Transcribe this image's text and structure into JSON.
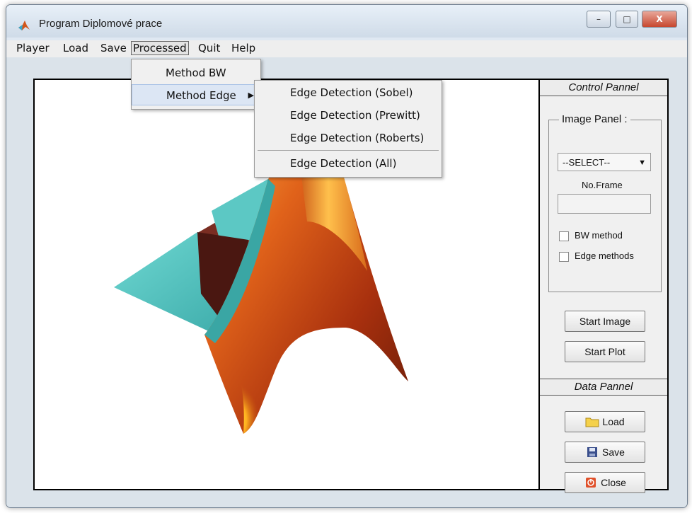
{
  "window": {
    "title": "Program Diplomové prace",
    "controls": [
      "–",
      "□",
      "X"
    ]
  },
  "menubar": [
    "Player",
    "Load",
    "Save",
    "Processed",
    "Quit",
    "Help"
  ],
  "processed_menu": {
    "items": [
      "Method BW",
      "Method Edge"
    ]
  },
  "edge_submenu": {
    "items": [
      "Edge Detection (Sobel)",
      "Edge Detection (Prewitt)",
      "Edge Detection (Roberts)",
      "Edge Detection (All)"
    ]
  },
  "control_panel": {
    "title": "Control Pannel",
    "image_panel_label": "Image Panel :",
    "select_value": "--SELECT--",
    "frame_label": "No.Frame",
    "checkbox_bw": "BW method",
    "checkbox_edge": "Edge methods",
    "start_image": "Start Image",
    "start_plot": "Start Plot"
  },
  "data_panel": {
    "title": "Data Pannel",
    "load": "Load",
    "save": "Save",
    "close": "Close"
  },
  "icons": {
    "app": "matlab-logo-icon",
    "load": "folder-icon",
    "save": "floppy-disk-icon",
    "close": "power-icon"
  }
}
